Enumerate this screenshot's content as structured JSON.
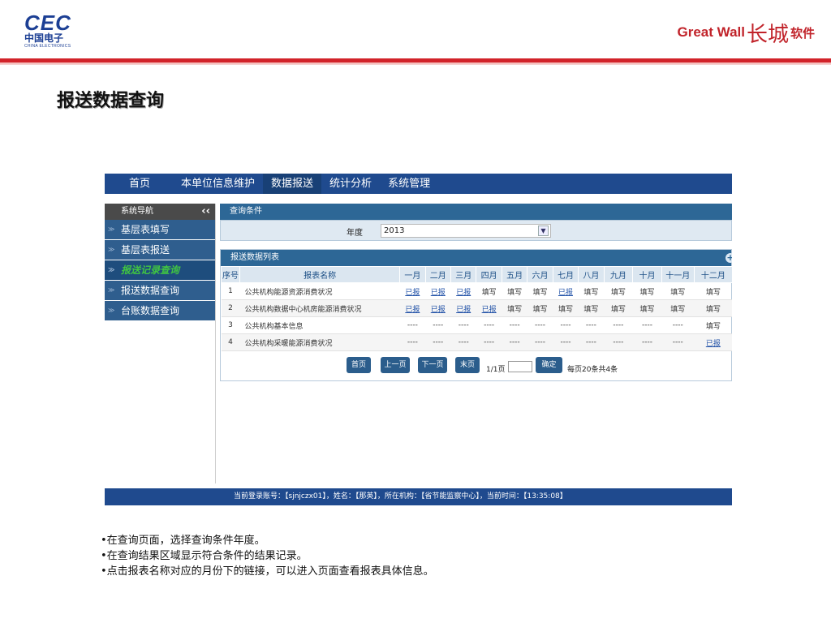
{
  "header": {
    "cec_logo": "CEC",
    "cec_cn": "中国电子",
    "cec_en": "CHINA ELECTRONICS",
    "gw_logo": "Great Wall",
    "gw_seal": "长城",
    "gw_suffix": "软件",
    "slide_title": "报送数据查询"
  },
  "topnav": [
    "首页",
    "本单位信息维护",
    "数据报送",
    "统计分析",
    "系统管理"
  ],
  "topnav_active": 2,
  "sidebar": {
    "title": "系统导航",
    "collapse_glyph": "‹‹",
    "items": [
      "基层表填写",
      "基层表报送",
      "报送记录查询",
      "报送数据查询",
      "台账数据查询"
    ],
    "current_index": 2
  },
  "query": {
    "panel_title": "查询条件",
    "year_label": "年度",
    "year_value": "2013"
  },
  "list": {
    "panel_title": "报送数据列表",
    "columns": [
      "序号",
      "报表名称",
      "一月",
      "二月",
      "三月",
      "四月",
      "五月",
      "六月",
      "七月",
      "八月",
      "九月",
      "十月",
      "十一月",
      "十二月"
    ],
    "rows": [
      {
        "no": "1",
        "name": "公共机构能源资源消费状况",
        "months": [
          "已报",
          "已报",
          "已报",
          "填写",
          "填写",
          "填写",
          "已报",
          "填写",
          "填写",
          "填写",
          "填写",
          "填写"
        ]
      },
      {
        "no": "2",
        "name": "公共机构数据中心机房能源消费状况",
        "months": [
          "已报",
          "已报",
          "已报",
          "已报",
          "填写",
          "填写",
          "填写",
          "填写",
          "填写",
          "填写",
          "填写",
          "填写"
        ]
      },
      {
        "no": "3",
        "name": "公共机构基本信息",
        "months": [
          "----",
          "----",
          "----",
          "----",
          "----",
          "----",
          "----",
          "----",
          "----",
          "----",
          "----",
          "填写"
        ]
      },
      {
        "no": "4",
        "name": "公共机构采暖能源消费状况",
        "months": [
          "----",
          "----",
          "----",
          "----",
          "----",
          "----",
          "----",
          "----",
          "----",
          "----",
          "----",
          "已报"
        ]
      }
    ]
  },
  "pager": {
    "first": "首页",
    "prev": "上一页",
    "next": "下一页",
    "last": "末页",
    "page_info": "1/1页",
    "confirm": "确定",
    "summary": "每页20条共4条"
  },
  "status_bar": "当前登录账号：【sjnjczx01】，姓名：【那英】，所在机构：【省节能监察中心】，当前时间：【13:35:08】",
  "notes": [
    "•在查询页面，选择查询条件年度。",
    "•在查询结果区域显示符合条件的结果记录。",
    "•点击报表名称对应的月份下的链接，可以进入页面查看报表具体信息。"
  ]
}
